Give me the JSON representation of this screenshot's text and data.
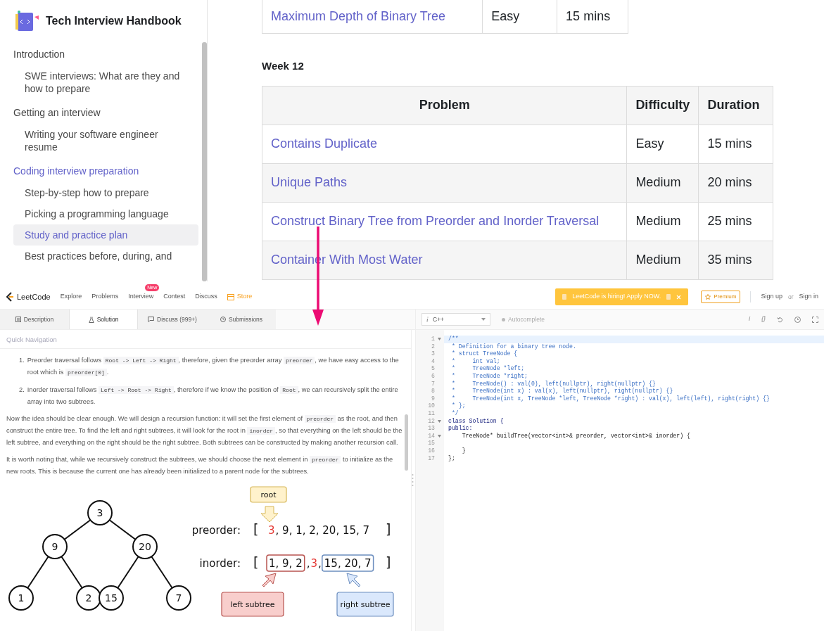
{
  "handbook": {
    "title": "Tech Interview Handbook",
    "nav": [
      {
        "label": "Introduction",
        "active": false,
        "children": [
          {
            "label": "SWE interviews: What are they and how to prepare",
            "selected": false
          }
        ]
      },
      {
        "label": "Getting an interview",
        "active": false,
        "children": [
          {
            "label": "Writing your software engineer resume",
            "selected": false
          }
        ]
      },
      {
        "label": "Coding interview preparation",
        "active": true,
        "children": [
          {
            "label": "Step-by-step how to prepare",
            "selected": false
          },
          {
            "label": "Picking a programming language",
            "selected": false
          },
          {
            "label": "Study and practice plan",
            "selected": true
          },
          {
            "label": "Best practices before, during, and",
            "selected": false
          }
        ]
      }
    ],
    "previous_table": {
      "rows": [
        [
          "Maximum Depth of Binary Tree",
          "Easy",
          "15 mins"
        ]
      ]
    },
    "section_title": "Week 12",
    "table": {
      "columns": [
        "Problem",
        "Difficulty",
        "Duration"
      ],
      "rows": [
        [
          "Contains Duplicate",
          "Easy",
          "15 mins"
        ],
        [
          "Unique Paths",
          "Medium",
          "20 mins"
        ],
        [
          "Construct Binary Tree from Preorder and Inorder Traversal",
          "Medium",
          "25 mins"
        ],
        [
          "Container With Most Water",
          "Medium",
          "35 mins"
        ]
      ]
    }
  },
  "leetcode": {
    "brand": "LeetCode",
    "links": [
      {
        "label": "Explore",
        "kind": "link"
      },
      {
        "label": "Problems",
        "kind": "link"
      },
      {
        "label": "Interview",
        "kind": "link",
        "badge": "New"
      },
      {
        "label": "Contest",
        "kind": "link"
      },
      {
        "label": "Discuss",
        "kind": "link"
      },
      {
        "label": "Store",
        "kind": "store"
      }
    ],
    "banner": "LeetCode is hiring! Apply NOW.",
    "premium": "Premium",
    "sign_up": "Sign up",
    "or": "or",
    "sign_in": "Sign in",
    "tabs": [
      {
        "label": "Description",
        "kind": "description",
        "selected": false
      },
      {
        "label": "Solution",
        "kind": "solution",
        "selected": true
      },
      {
        "label": "Discuss (999+)",
        "kind": "discuss",
        "selected": false
      },
      {
        "label": "Submissions",
        "kind": "submissions",
        "selected": false
      }
    ],
    "quick_nav": "Quick Navigation",
    "list": [
      {
        "marker": "1.",
        "segments": [
          {
            "kind": "text",
            "text": "Preorder traversal follows "
          },
          {
            "kind": "code",
            "text": "Root -> Left -> Right"
          },
          {
            "kind": "text",
            "text": ", therefore, given the preorder array "
          },
          {
            "kind": "code",
            "text": "preorder"
          },
          {
            "kind": "text",
            "text": ", we have easy access to the root which is "
          },
          {
            "kind": "code",
            "text": "preorder[0]"
          },
          {
            "kind": "text",
            "text": "."
          }
        ]
      },
      {
        "marker": "2.",
        "segments": [
          {
            "kind": "text",
            "text": "Inorder traversal follows "
          },
          {
            "kind": "code",
            "text": "Left -> Root -> Right"
          },
          {
            "kind": "text",
            "text": ", therefore if we know the position of "
          },
          {
            "kind": "code",
            "text": "Root"
          },
          {
            "kind": "text",
            "text": ", we can recursively split the entire array into two subtrees."
          }
        ]
      }
    ],
    "paragraphs": [
      [
        {
          "kind": "text",
          "text": "Now the idea should be clear enough. We will design a recursion function: it will set the first element of "
        },
        {
          "kind": "code",
          "text": "preorder"
        },
        {
          "kind": "text",
          "text": " as the root, and then construct the entire tree. To find the left and right subtrees, it will look for the root in "
        },
        {
          "kind": "code",
          "text": "inorder"
        },
        {
          "kind": "text",
          "text": ", so that everything on the left should be the left subtree, and everything on the right should be the right subtree. Both subtrees can be constructed by making another recursion call."
        }
      ],
      [
        {
          "kind": "text",
          "text": "It is worth noting that, while we recursively construct the subtrees, we should choose the next element in "
        },
        {
          "kind": "code",
          "text": "preorder"
        },
        {
          "kind": "text",
          "text": " to initialize as the new roots. This is because the current one has already been initialized to a parent node for the subtrees."
        }
      ]
    ],
    "diagram": {
      "tree": {
        "value": "3",
        "children": [
          {
            "value": "9",
            "children": [
              {
                "value": "1"
              },
              {
                "value": "2"
              }
            ]
          },
          {
            "value": "20",
            "children": [
              {
                "value": "15"
              },
              {
                "value": "7"
              }
            ]
          }
        ]
      },
      "root_label": "root",
      "left_label": "left subtree",
      "right_label": "right subtree",
      "preorder": {
        "label": "preorder:",
        "open": "[",
        "close": "]",
        "segments": [
          {
            "kind": "root",
            "text": "3"
          },
          {
            "kind": "plain",
            "text": ", 9, 1, 2, 20, 15, 7"
          }
        ]
      },
      "inorder": {
        "label": "inorder:",
        "open": "[",
        "close": "]",
        "segments": [
          {
            "kind": "left",
            "text": "1, 9, 2"
          },
          {
            "kind": "middle",
            "parts": [
              {
                "kind": "plain",
                "text": ","
              },
              {
                "kind": "root",
                "text": "3"
              },
              {
                "kind": "plain",
                "text": ","
              }
            ]
          },
          {
            "kind": "right",
            "text": "15, 20, 7"
          }
        ]
      }
    },
    "editor": {
      "language": "C++",
      "autocomplete": "Autocomplete",
      "tools": [
        {
          "kind": "glyph",
          "text": "i"
        },
        {
          "kind": "glyph",
          "text": "{}"
        },
        {
          "kind": "reset"
        },
        {
          "kind": "clock"
        },
        {
          "kind": "fullscreen"
        }
      ],
      "lines": [
        {
          "number": "1",
          "fold": true,
          "selected": true,
          "kind": "comment",
          "text": "/**"
        },
        {
          "number": "2",
          "fold": false,
          "selected": false,
          "kind": "comment",
          "text": " * Definition for a binary tree node."
        },
        {
          "number": "3",
          "fold": false,
          "selected": false,
          "kind": "comment",
          "text": " * struct TreeNode {"
        },
        {
          "number": "4",
          "fold": false,
          "selected": false,
          "kind": "comment",
          "text": " *     int val;"
        },
        {
          "number": "5",
          "fold": false,
          "selected": false,
          "kind": "comment",
          "text": " *     TreeNode *left;"
        },
        {
          "number": "6",
          "fold": false,
          "selected": false,
          "kind": "comment",
          "text": " *     TreeNode *right;"
        },
        {
          "number": "7",
          "fold": false,
          "selected": false,
          "kind": "comment",
          "text": " *     TreeNode() : val(0), left(nullptr), right(nullptr) {}"
        },
        {
          "number": "8",
          "fold": false,
          "selected": false,
          "kind": "comment",
          "text": " *     TreeNode(int x) : val(x), left(nullptr), right(nullptr) {}"
        },
        {
          "number": "9",
          "fold": false,
          "selected": false,
          "kind": "comment",
          "text": " *     TreeNode(int x, TreeNode *left, TreeNode *right) : val(x), left(left), right(right) {}"
        },
        {
          "number": "10",
          "fold": false,
          "selected": false,
          "kind": "comment",
          "text": " * };"
        },
        {
          "number": "11",
          "fold": false,
          "selected": false,
          "kind": "comment",
          "text": " */"
        },
        {
          "number": "12",
          "fold": true,
          "selected": false,
          "kind": "keyword",
          "text": "class Solution {"
        },
        {
          "number": "13",
          "fold": false,
          "selected": false,
          "kind": "keyword",
          "text": "public:"
        },
        {
          "number": "14",
          "fold": true,
          "selected": false,
          "kind": "code",
          "text": "    TreeNode* buildTree(vector<int>& preorder, vector<int>& inorder) {"
        },
        {
          "number": "15",
          "fold": false,
          "selected": false,
          "kind": "code"
        },
        {
          "number": "16",
          "fold": false,
          "selected": false,
          "kind": "code",
          "text": "    }"
        },
        {
          "number": "17",
          "fold": false,
          "selected": false,
          "kind": "code",
          "text": "};"
        }
      ]
    }
  }
}
